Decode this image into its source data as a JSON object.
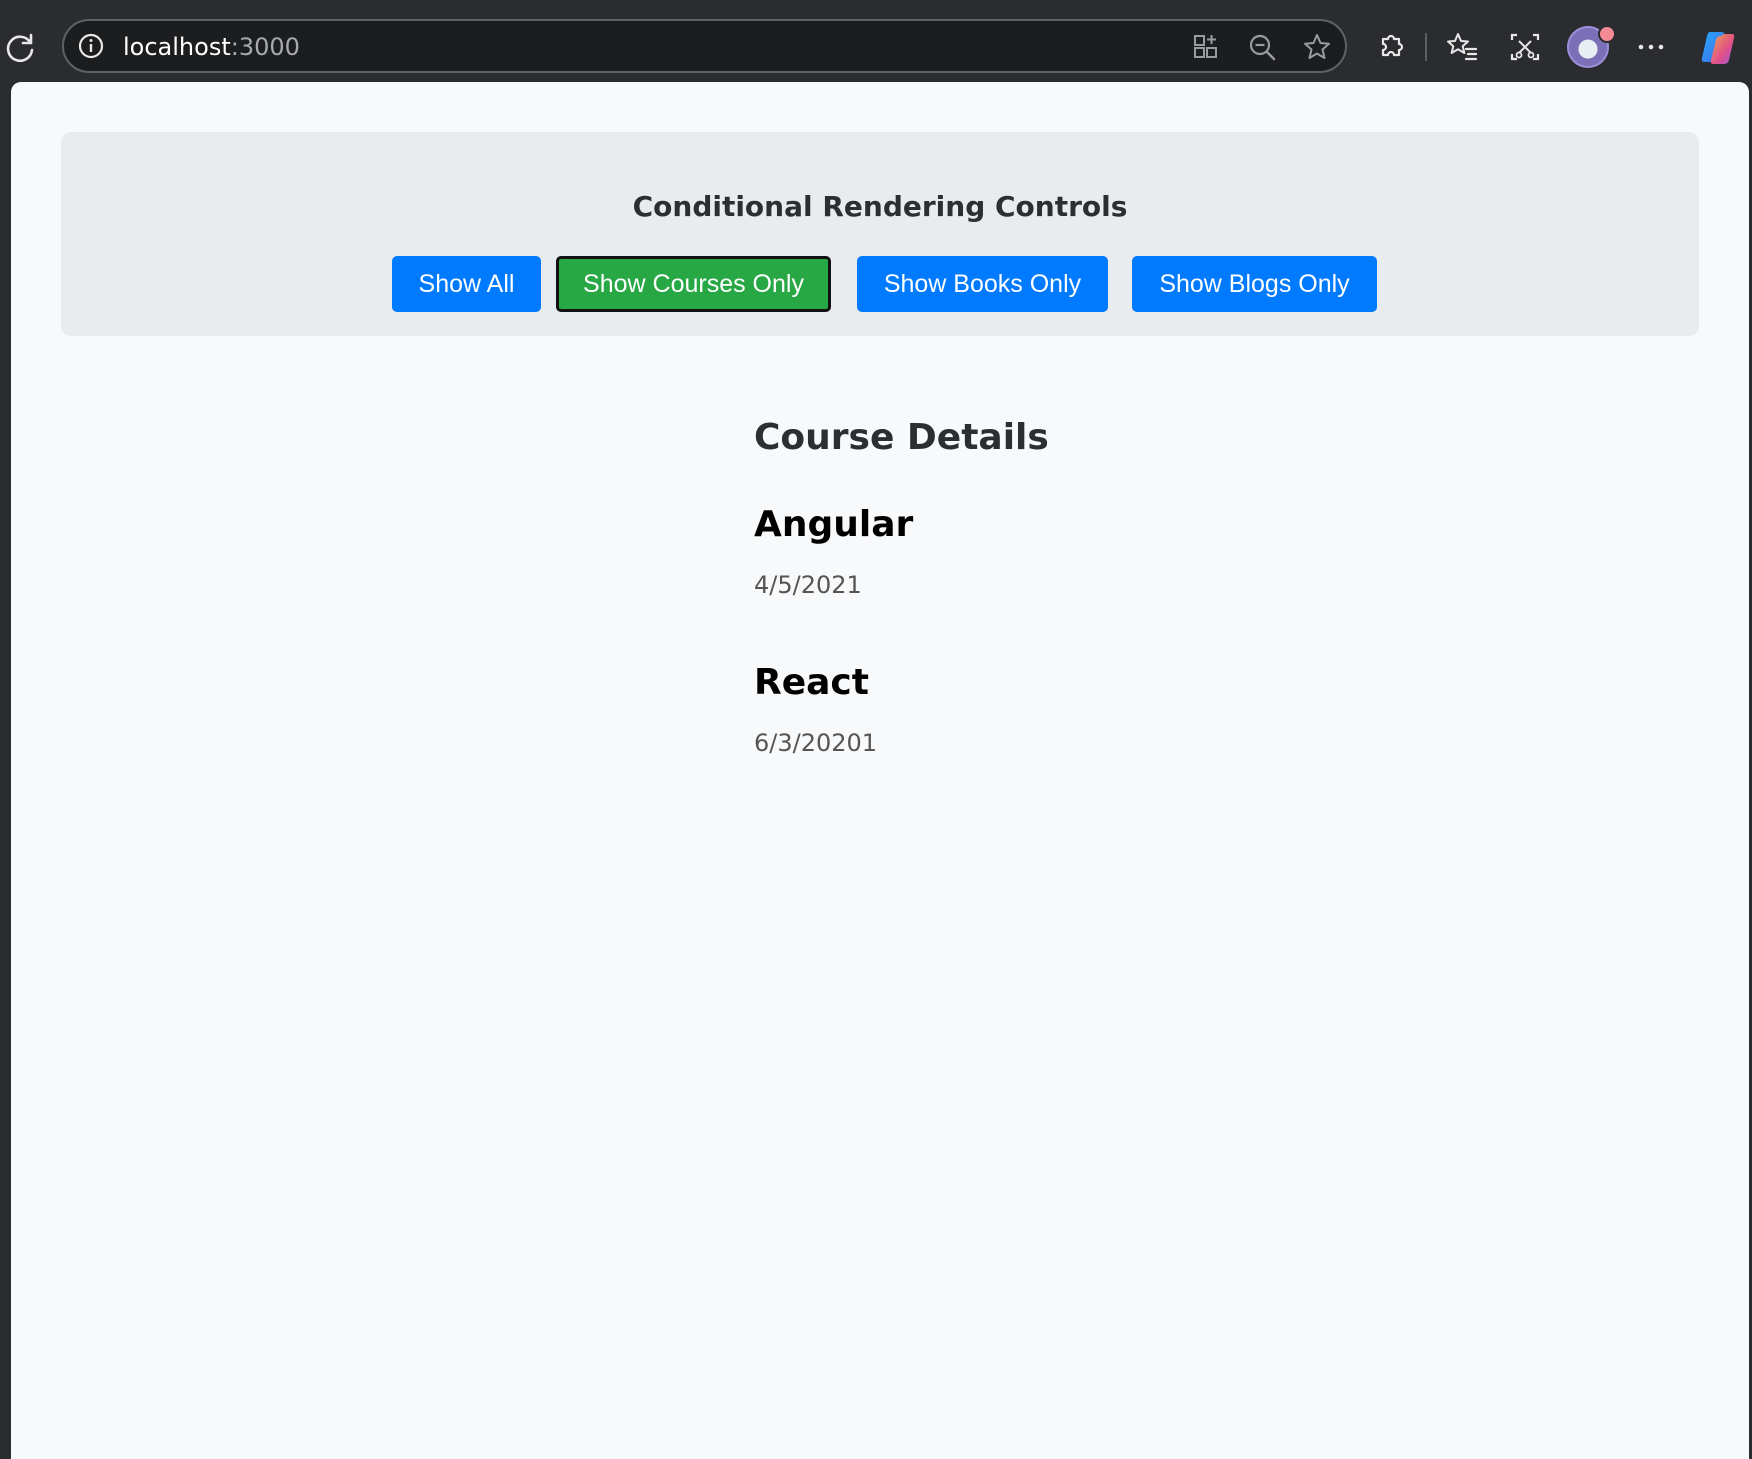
{
  "browser": {
    "url_host": "localhost",
    "url_port": ":3000",
    "icons": [
      "reload-icon",
      "site-info-icon",
      "app-available-icon",
      "zoom-out-icon",
      "favorite-star-icon",
      "extensions-icon",
      "favorites-icon",
      "screenshot-icon",
      "profile-avatar",
      "more-icon",
      "copilot-icon"
    ]
  },
  "controls": {
    "title": "Conditional Rendering Controls",
    "buttons": [
      {
        "label": "Show All",
        "active": false
      },
      {
        "label": "Show Courses Only",
        "active": true
      },
      {
        "label": "Show Books Only",
        "active": false
      },
      {
        "label": "Show Blogs Only",
        "active": false
      }
    ]
  },
  "course_details": {
    "heading": "Course Details",
    "courses": [
      {
        "name": "Angular",
        "date": "4/5/2021"
      },
      {
        "name": "React",
        "date": "6/3/20201"
      }
    ]
  },
  "colors": {
    "button_blue": "#007bff",
    "button_active_green": "#28a745",
    "panel_bg": "#e9ecef",
    "page_bg": "#f8f9fa",
    "chrome_bg": "#2b2c2f"
  }
}
